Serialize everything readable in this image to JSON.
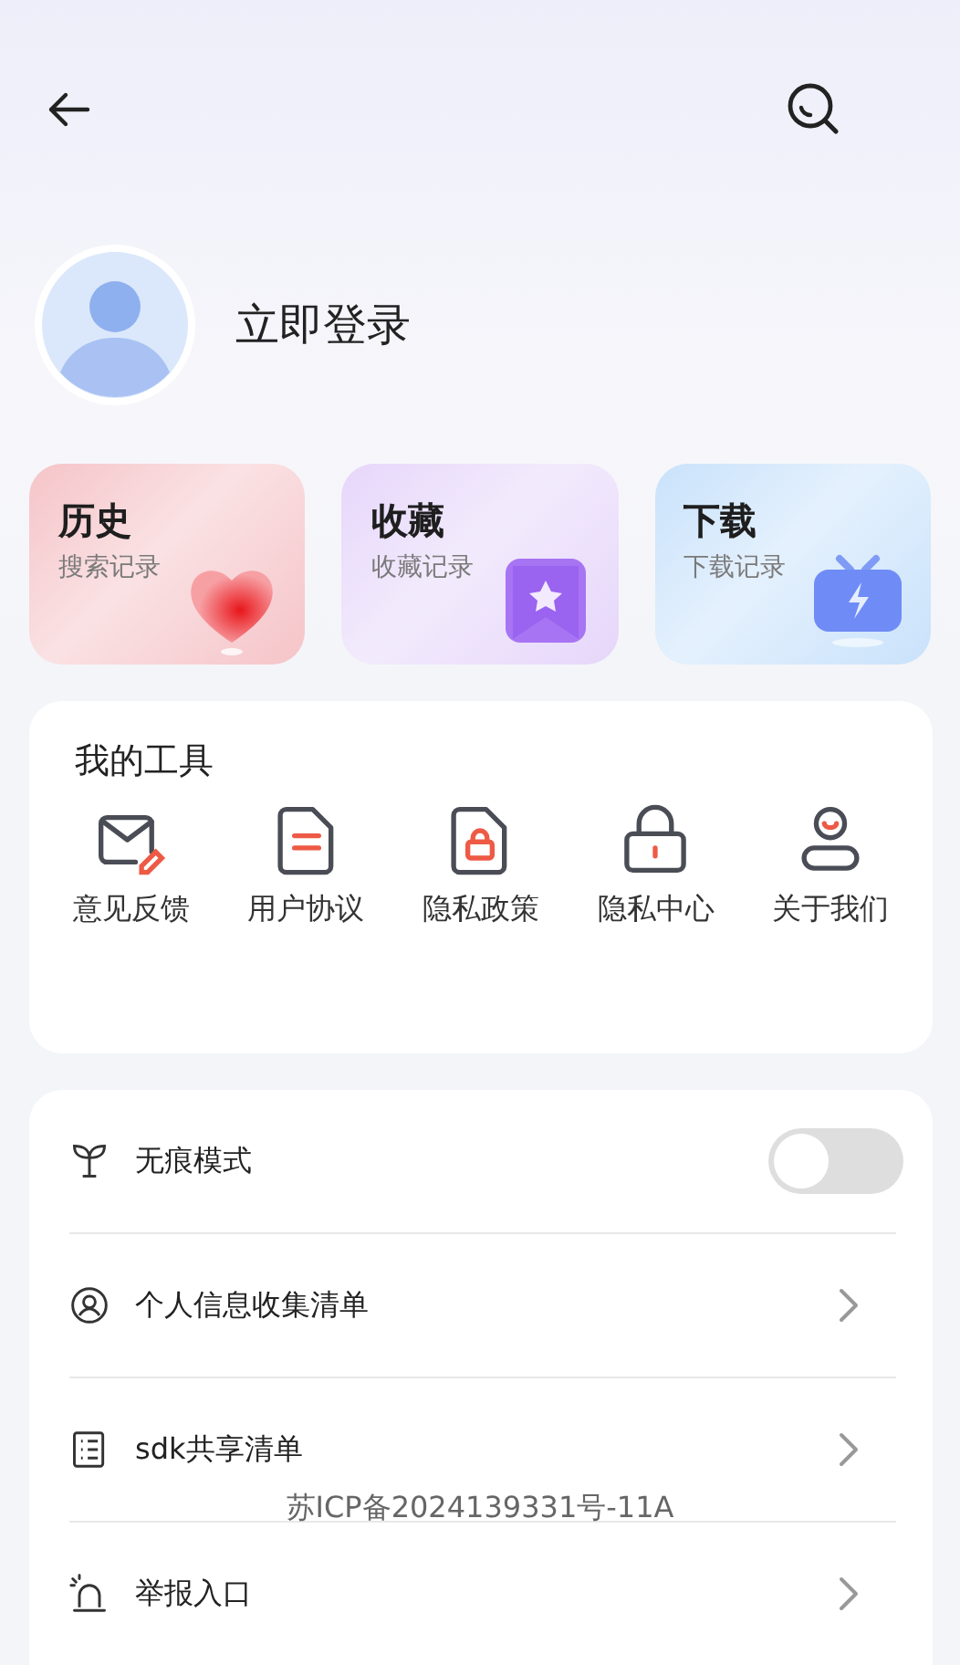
{
  "profile": {
    "login_label": "立即登录"
  },
  "quick_cards": [
    {
      "title": "历史",
      "subtitle": "搜索记录",
      "color": "#f5c4c8"
    },
    {
      "title": "收藏",
      "subtitle": "收藏记录",
      "color": "#e6d6fa"
    },
    {
      "title": "下载",
      "subtitle": "下载记录",
      "color": "#c9e2fb"
    }
  ],
  "tools": {
    "title": "我的工具",
    "items": [
      {
        "label": "意见反馈"
      },
      {
        "label": "用户协议"
      },
      {
        "label": "隐私政策"
      },
      {
        "label": "隐私中心"
      },
      {
        "label": "关于我们"
      }
    ]
  },
  "settings": [
    {
      "kind": "toggle",
      "label": "无痕模式",
      "on": false
    },
    {
      "kind": "link",
      "label": "个人信息收集清单"
    },
    {
      "kind": "link",
      "label": "sdk共享清单"
    },
    {
      "kind": "link",
      "label": "举报入口"
    }
  ],
  "footer": {
    "icp": "苏ICP备2024139331号-11A"
  }
}
